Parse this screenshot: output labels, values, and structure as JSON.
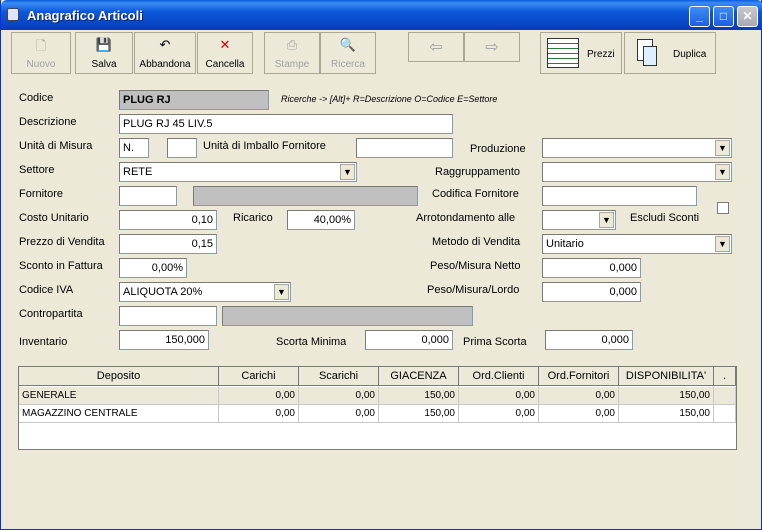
{
  "window": {
    "title": "Anagrafico Articoli"
  },
  "toolbar": {
    "nuovo": "Nuovo",
    "salva": "Salva",
    "abbandona": "Abbandona",
    "cancella": "Cancella",
    "stampe": "Stampe",
    "ricerca": "Ricerca",
    "prezzi": "Prezzi",
    "duplica": "Duplica",
    "back_icon": "⇦",
    "forward_icon": "⇨"
  },
  "form": {
    "codice_label": "Codice",
    "codice_value": "PLUG RJ",
    "search_hint": "Ricerche -> [Alt]+ R=Descrizione O=Codice E=Settore",
    "descrizione_label": "Descrizione",
    "descrizione_value": "PLUG RJ 45 LIV.5",
    "unita_misura_label": "Unità di Misura",
    "unita_misura_value": "N.",
    "unita_imballo_label": "Unità di Imballo Fornitore",
    "unita_imballo_value": "",
    "produzione_label": "Produzione",
    "produzione_value": "",
    "settore_label": "Settore",
    "settore_value": "RETE",
    "raggruppamento_label": "Raggruppamento",
    "raggruppamento_value": "",
    "fornitore_label": "Fornitore",
    "fornitore_code": "",
    "fornitore_name": "",
    "codifica_fornitore_label": "Codifica Fornitore",
    "codifica_fornitore_value": "",
    "costo_unitario_label": "Costo Unitario",
    "costo_unitario_value": "0,10",
    "ricarico_label": "Ricarico",
    "ricarico_value": "40,00%",
    "arrotondamento_label": "Arrotondamento alle",
    "arrotondamento_value": "",
    "escludi_sconti_label": "Escludi Sconti",
    "prezzo_vendita_label": "Prezzo di Vendita",
    "prezzo_vendita_value": "0,15",
    "metodo_vendita_label": "Metodo di Vendita",
    "metodo_vendita_value": "Unitario",
    "sconto_fattura_label": "Sconto in Fattura",
    "sconto_fattura_value": "0,00%",
    "peso_netto_label": "Peso/Misura Netto",
    "peso_netto_value": "0,000",
    "codice_iva_label": "Codice IVA",
    "codice_iva_value": "ALIQUOTA 20%",
    "peso_lordo_label": "Peso/Misura/Lordo",
    "peso_lordo_value": "0,000",
    "contropartita_label": "Contropartita",
    "contropartita_code": "",
    "contropartita_name": "",
    "inventario_label": "Inventario",
    "inventario_value": "150,000",
    "scorta_minima_label": "Scorta Minima",
    "scorta_minima_value": "0,000",
    "prima_scorta_label": "Prima Scorta",
    "prima_scorta_value": "0,000",
    "dropdown_arrow": "▼"
  },
  "grid": {
    "headers": [
      "Deposito",
      "Carichi",
      "Scarichi",
      "GIACENZA",
      "Ord.Clienti",
      "Ord.Fornitori",
      "DISPONIBILITA'",
      "."
    ],
    "rows": [
      [
        "GENERALE",
        "0,00",
        "0,00",
        "150,00",
        "0,00",
        "0,00",
        "150,00"
      ],
      [
        "MAGAZZINO CENTRALE",
        "0,00",
        "0,00",
        "150,00",
        "0,00",
        "0,00",
        "150,00"
      ]
    ]
  }
}
